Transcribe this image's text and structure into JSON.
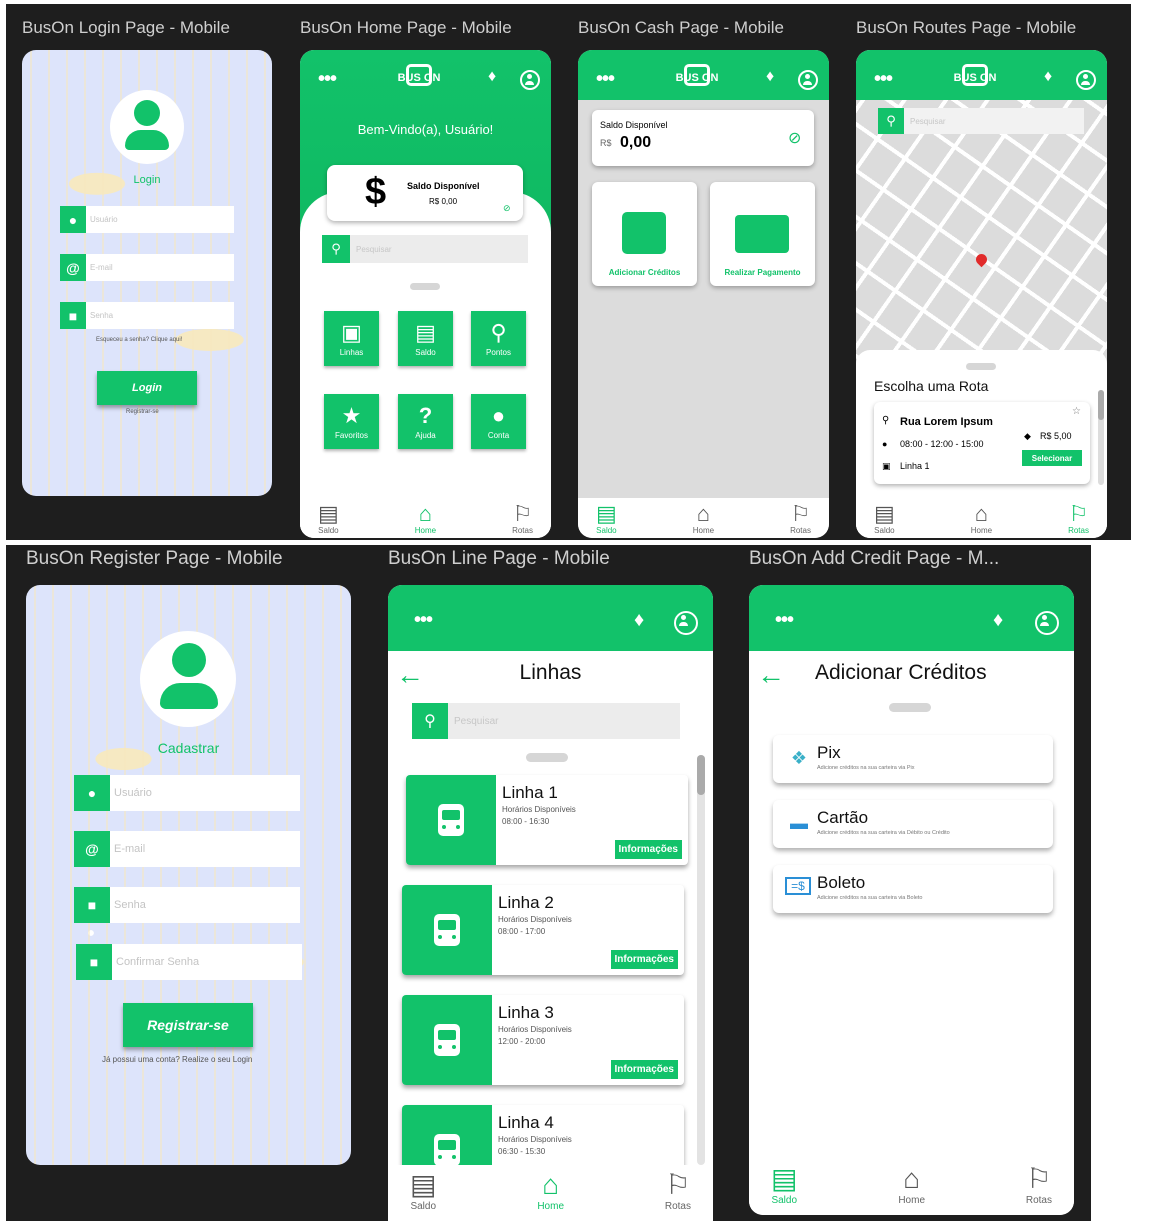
{
  "frames": {
    "login": {
      "title": "BusOn Login Page - Mobile",
      "heading": "Login",
      "user_ph": "Usuário",
      "email_ph": "E-mail",
      "pass_ph": "Senha",
      "forgot": "Esqueceu a senha? Clique aqui!",
      "login_btn": "Login",
      "register_link": "Registrar-se"
    },
    "home": {
      "title": "BusOn Home Page - Mobile",
      "logo": "BUS ON",
      "welcome": "Bem-Vindo(a), Usuário!",
      "balance_label": "Saldo Disponível",
      "balance_value": "R$ 0,00",
      "search_ph": "Pesquisar",
      "tiles": [
        {
          "label": "Linhas",
          "icon": "bus-icon"
        },
        {
          "label": "Saldo",
          "icon": "cash-icon"
        },
        {
          "label": "Pontos",
          "icon": "map-pin-icon"
        },
        {
          "label": "Favoritos",
          "icon": "star-icon"
        },
        {
          "label": "Ajuda",
          "icon": "help-icon"
        },
        {
          "label": "Conta",
          "icon": "user-icon"
        }
      ]
    },
    "cash": {
      "title": "BusOn Cash Page - Mobile",
      "logo": "BUS ON",
      "balance_label": "Saldo Disponível",
      "currency": "R$",
      "balance_value": "0,00",
      "add_credits": "Adicionar Créditos",
      "make_payment": "Realizar Pagamento"
    },
    "routes": {
      "title": "BusOn Routes Page - Mobile",
      "logo": "BUS ON",
      "search_ph": "Pesquisar",
      "choose": "Escolha uma Rota",
      "street": "Rua Lorem Ipsum",
      "times": "08:00 - 12:00 - 15:00",
      "line": "Linha 1",
      "price": "R$ 5,00",
      "select": "Selecionar"
    },
    "register": {
      "title": "BusOn Register Page - Mobile",
      "heading": "Cadastrar",
      "user_ph": "Usuário",
      "email_ph": "E-mail",
      "pass_ph": "Senha",
      "confirm_ph": "Confirmar Senha",
      "register_btn": "Registrar-se",
      "login_link": "Já possui uma conta? Realize o seu Login"
    },
    "lines": {
      "title": "BusOn Line Page - Mobile",
      "heading": "Linhas",
      "search_ph": "Pesquisar",
      "avail": "Horários Disponíveis",
      "info_btn": "Informações",
      "items": [
        {
          "name": "Linha 1",
          "time": "08:00 - 16:30"
        },
        {
          "name": "Linha 2",
          "time": "08:00 - 17:00"
        },
        {
          "name": "Linha 3",
          "time": "12:00 - 20:00"
        },
        {
          "name": "Linha 4",
          "time": "06:30 - 15:30"
        }
      ]
    },
    "addcredit": {
      "title": "BusOn Add Credit Page - M...",
      "heading": "Adicionar Créditos",
      "options": [
        {
          "name": "Pix",
          "desc": "Adicione créditos na sua carteira via Pix",
          "icon": "pix-icon"
        },
        {
          "name": "Cartão",
          "desc": "Adicione créditos na sua carteira via Débito ou Crédito",
          "icon": "card-icon"
        },
        {
          "name": "Boleto",
          "desc": "Adicione créditos na sua carteira via Boleto",
          "icon": "boleto-icon"
        }
      ]
    }
  },
  "nav": {
    "saldo": "Saldo",
    "home": "Home",
    "rotas": "Rotas"
  },
  "colors": {
    "accent": "#12c26a",
    "frame_bg": "#1e1e1e",
    "login_bg": "#dde4fb"
  }
}
